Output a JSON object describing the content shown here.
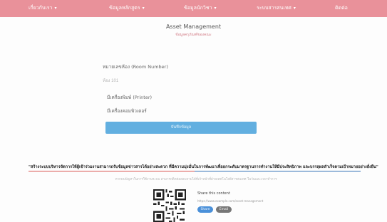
{
  "nav": {
    "items": [
      {
        "label": "เกี่ยวกับเรา",
        "dropdown": true
      },
      {
        "label": "ข้อมูลหลักสูตร",
        "dropdown": true
      },
      {
        "label": "ข้อมูลนักวิชา",
        "dropdown": true
      },
      {
        "label": "ระบบสารสนเทศ",
        "dropdown": true
      },
      {
        "label": "ติดต่อ",
        "dropdown": false
      }
    ]
  },
  "header": {
    "title": "Asset Management",
    "subtitle": "ข้อมูลครุภัณฑ์ของคณะ"
  },
  "form": {
    "room_label": "หมายเลขห้อง (Room Number)",
    "room_placeholder": "ห้อง 101",
    "options": [
      {
        "label": "มีเครื่องพิมพ์ (Printer)"
      },
      {
        "label": "มีเครื่องคอมพิวเตอร์"
      }
    ],
    "submit_label": "บันทึกข้อมูล"
  },
  "footer": {
    "notice": "\"สร้างระบบบริหารจัดการให้ผู้เข้าร่วมงานสามารถรับข้อมูลข่าวสารได้อย่างสะดวก ที่มีความมุ่งมั่นในการพัฒนาเพื่อยกระดับมาตรฐานการทำงานให้มีประสิทธิภาพ และบรรลุผลสำเร็จตามเป้าหมายอย่างยั่งยืน\"",
    "note": "หากพบปัญหาในการใช้งานระบบ สามารถติดต่อสอบถามได้ที่เจ้าหน้าที่ฝ่ายเทคโนโลยีสารสนเทศ ในวันและเวลาทำการ",
    "share_title": "Share this content",
    "share_url": "https://www.example.com/asset-management",
    "share_buttons": [
      "Share",
      "Email"
    ]
  },
  "colors": {
    "nav_bg": "#e9919a",
    "accent_button": "#62afe0",
    "notice_rule_red": "#d9534f",
    "notice_rule_blue": "#2f6fb5"
  }
}
